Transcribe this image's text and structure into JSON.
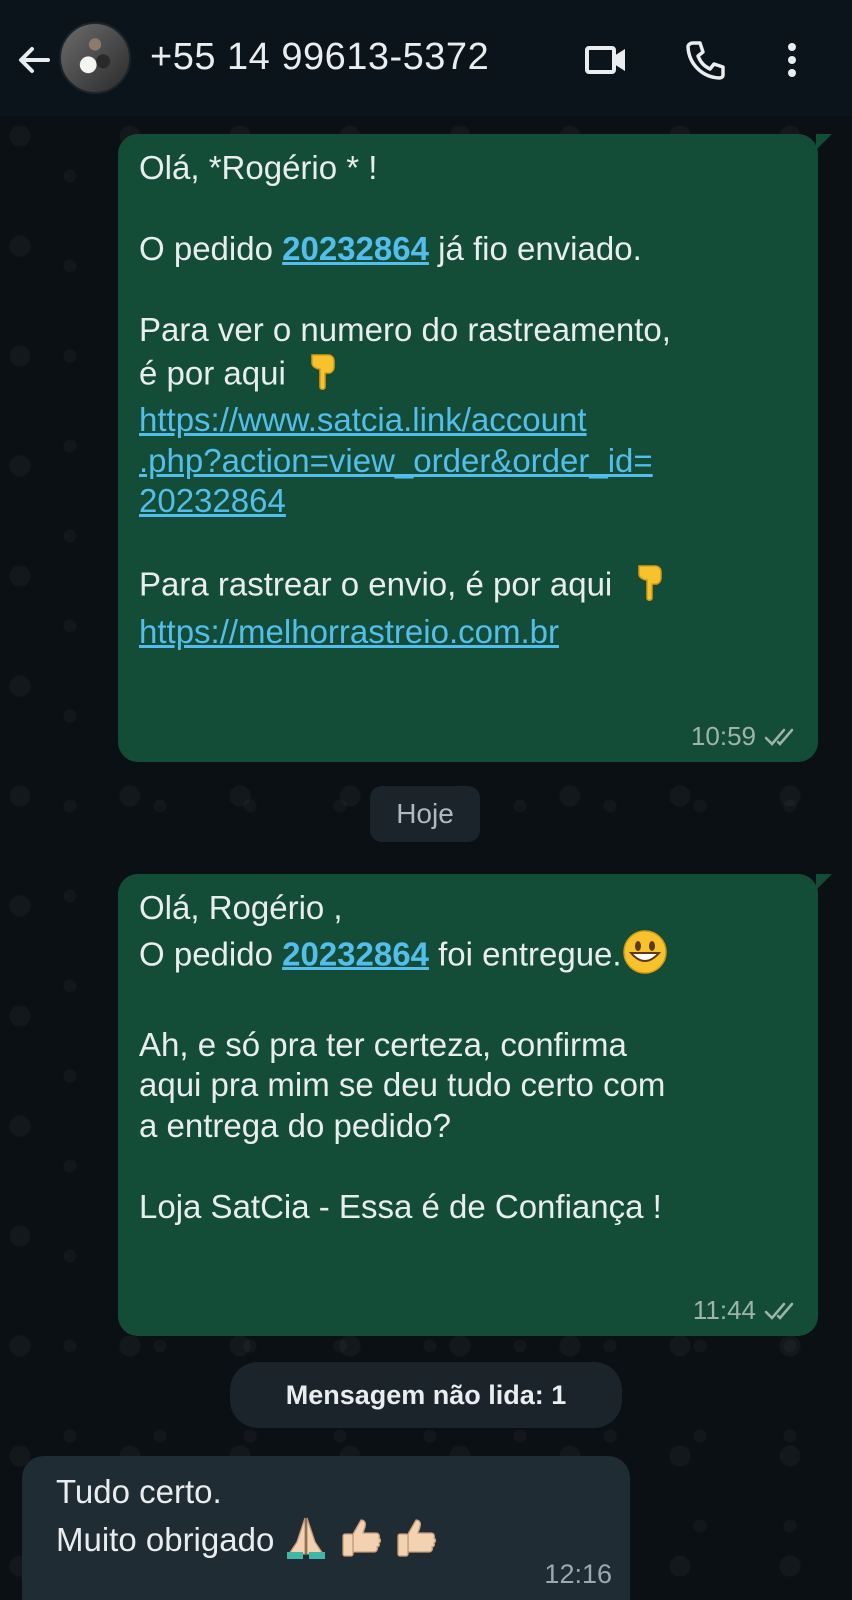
{
  "header": {
    "contact_name": "+55 14 99613-5372"
  },
  "messages": {
    "m1": {
      "greeting": "Olá, *Rogério * !",
      "order_prefix": "O pedido ",
      "order_number": "20232864",
      "order_suffix": " já fio enviado.",
      "tracking_line1": "Para ver o numero do rastreamento,",
      "tracking_line2": "é por aqui",
      "tracking_link_1": "https://www.satcia.link/account",
      "tracking_link_2": ".php?action=view_order&order_id=",
      "tracking_link_3": "20232864",
      "ship_line": "Para rastrear o envio, é por aqui",
      "ship_link": "https://melhorrastreio.com.br",
      "time": "10:59"
    },
    "day_badge": "Hoje",
    "m2": {
      "greeting": "Olá, Rogério ,",
      "order_prefix": "O pedido ",
      "order_number": "20232864",
      "order_suffix": " foi entregue.",
      "confirm_1": "Ah, e só pra ter certeza, confirma",
      "confirm_2": "aqui pra mim se deu tudo certo com",
      "confirm_3": "a entrega do pedido?",
      "signature": "Loja SatCia - Essa é de Confiança !",
      "time": "11:44"
    },
    "unread_badge": "Mensagem não lida: 1",
    "m3": {
      "line1": "Tudo certo.",
      "line2": "Muito obrigado",
      "time": "12:16"
    }
  },
  "icons": {
    "back": "arrow-left-icon",
    "video": "video-call-icon",
    "call": "phone-icon",
    "menu": "more-vertical-icon",
    "read": "double-check-icon",
    "pointing": "pointing-down-emoji",
    "smile": "grinning-emoji",
    "pray": "folded-hands-emoji",
    "thumbs": "thumbs-up-emoji"
  },
  "colors": {
    "header_bg": "#0b141a",
    "outgoing_bubble": "#144d37",
    "incoming_bubble": "#1f2c33",
    "link": "#53bdeb"
  }
}
